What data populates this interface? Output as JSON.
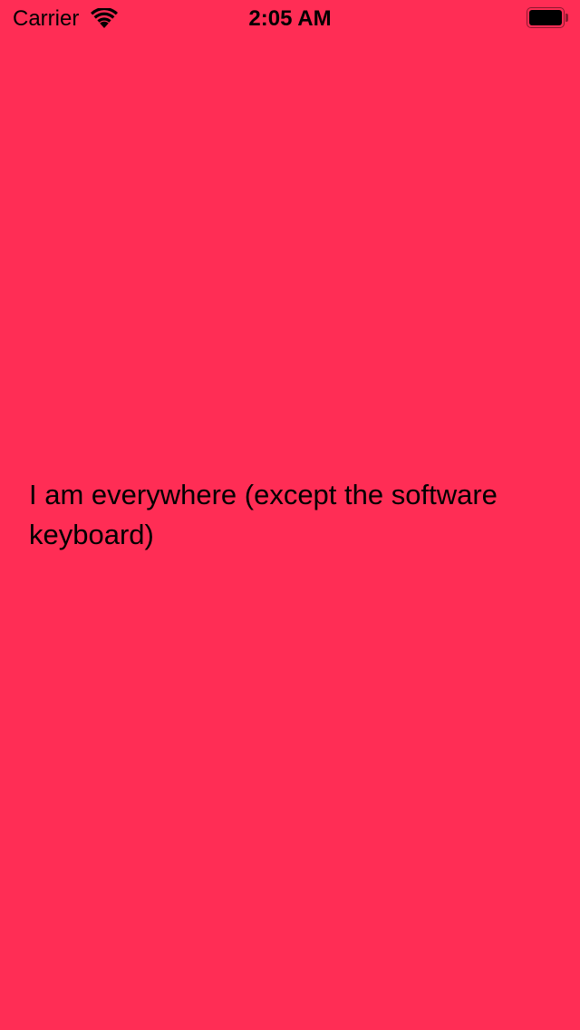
{
  "status_bar": {
    "carrier": "Carrier",
    "time": "2:05 AM",
    "wifi_icon": "wifi-icon",
    "battery_icon": "battery-icon"
  },
  "main": {
    "message": "I am everywhere (except the software keyboard)"
  },
  "colors": {
    "background": "#FF2D55",
    "text": "#000000"
  }
}
